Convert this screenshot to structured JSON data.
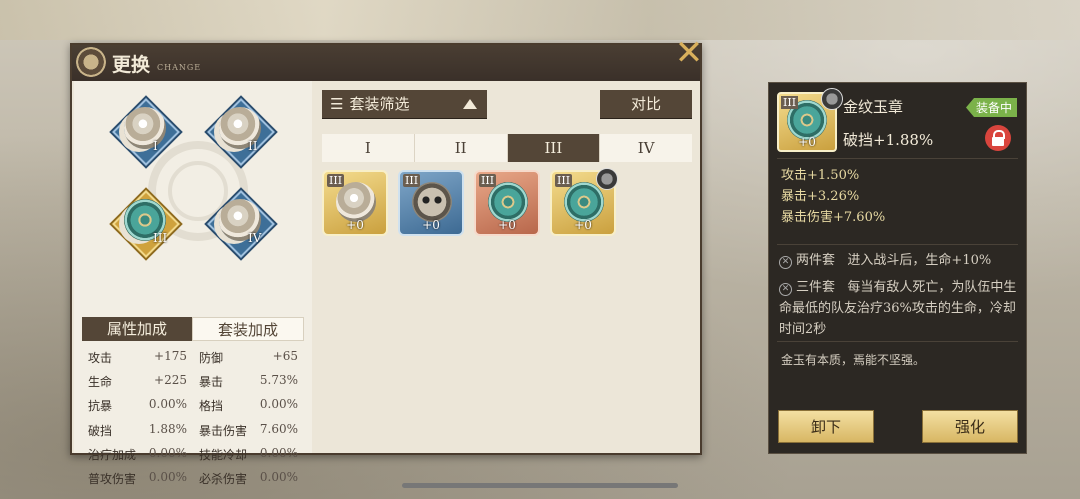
{
  "header": {
    "title": "更换",
    "subtitle": "CHANGE"
  },
  "slots": [
    {
      "numeral": "I",
      "type": "shell",
      "active": false
    },
    {
      "numeral": "II",
      "type": "shell",
      "active": false
    },
    {
      "numeral": "III",
      "type": "jade",
      "active": true
    },
    {
      "numeral": "IV",
      "type": "shell",
      "active": false
    }
  ],
  "left_tabs": {
    "attr": "属性加成",
    "set": "套装加成"
  },
  "stats": [
    [
      {
        "k": "攻击",
        "v": "+175"
      },
      {
        "k": "防御",
        "v": "+65"
      }
    ],
    [
      {
        "k": "生命",
        "v": "+225"
      },
      {
        "k": "暴击",
        "v": "5.73%"
      }
    ],
    [
      {
        "k": "抗暴",
        "v": "0.00%"
      },
      {
        "k": "格挡",
        "v": "0.00%"
      }
    ],
    [
      {
        "k": "破挡",
        "v": "1.88%"
      },
      {
        "k": "暴击伤害",
        "v": "7.60%"
      }
    ],
    [
      {
        "k": "治疗加成",
        "v": "0.00%"
      },
      {
        "k": "技能冷却",
        "v": "0.00%"
      }
    ],
    [
      {
        "k": "普攻伤害",
        "v": "0.00%"
      },
      {
        "k": "必杀伤害",
        "v": "0.00%"
      }
    ]
  ],
  "filter": {
    "label": "套装筛选",
    "compare": "对比"
  },
  "tier_tabs": [
    "I",
    "II",
    "III",
    "IV"
  ],
  "selected_tier": "III",
  "items": [
    {
      "tier": "III",
      "level": "+0",
      "frame": "gold",
      "icon": "shell",
      "equipped": false
    },
    {
      "tier": "III",
      "level": "+0",
      "frame": "blue",
      "icon": "mask",
      "equipped": false
    },
    {
      "tier": "III",
      "level": "+0",
      "frame": "red",
      "icon": "jade",
      "equipped": false
    },
    {
      "tier": "III",
      "level": "+0",
      "frame": "gold",
      "icon": "jade",
      "equipped": true
    }
  ],
  "detail": {
    "tier": "III",
    "level": "+0",
    "name": "金纹玉章",
    "badge": "装备中",
    "main_stat": "破挡+1.88%",
    "sub_stats": [
      "攻击+1.50%",
      "暴击+3.26%",
      "暴击伤害+7.60%"
    ],
    "set2_label": "两件套",
    "set2_text": "进入战斗后，生命+10%",
    "set3_label": "三件套",
    "set3_text": "每当有敌人死亡，为队伍中生命最低的队友治疗36%攻击的生命，冷却时间2秒",
    "flavor": "金玉有本质，焉能不坚强。",
    "unequip": "卸下",
    "enhance": "强化"
  }
}
